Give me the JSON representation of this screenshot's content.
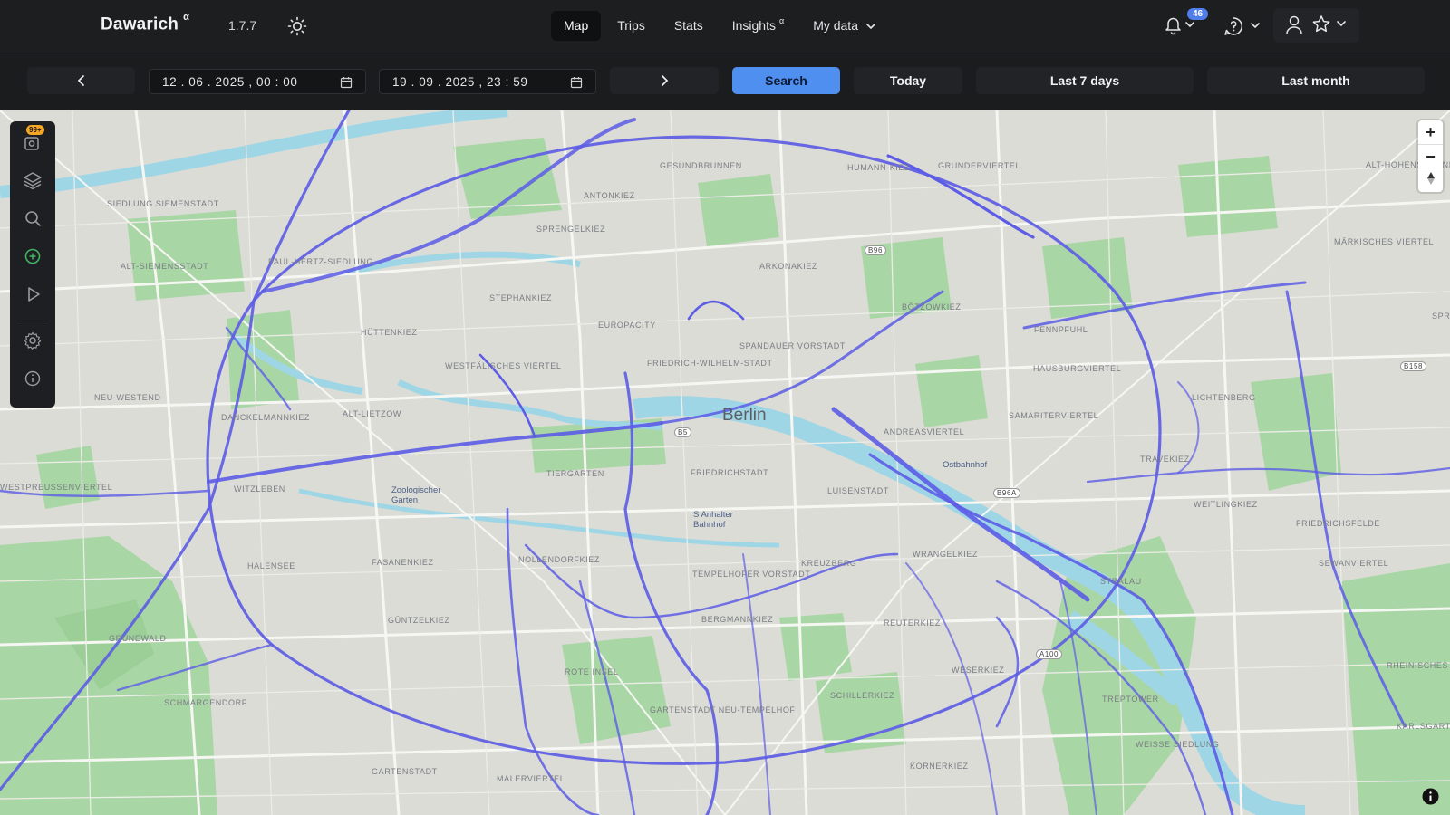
{
  "app": {
    "name": "Dawarich",
    "name_sup": "α",
    "version": "1.7.7"
  },
  "nav": {
    "links": [
      {
        "label": "Map",
        "active": true
      },
      {
        "label": "Trips"
      },
      {
        "label": "Stats"
      },
      {
        "label": "Insights",
        "sup": "α"
      },
      {
        "label": "My data",
        "dropdown": true
      }
    ]
  },
  "notifications": {
    "count": "46"
  },
  "toolbar": {
    "start_date": "12 . 06 . 2025 ,  00 : 00",
    "end_date": "19 . 09 . 2025 ,  23 : 59",
    "search_label": "Search",
    "today_label": "Today",
    "last7_label": "Last 7 days",
    "lastmonth_label": "Last month"
  },
  "sidebar": {
    "points_badge": "99+",
    "icons": [
      "points-icon",
      "layers-icon",
      "search-icon",
      "add-place-icon",
      "play-icon",
      "settings-icon",
      "info-icon"
    ]
  },
  "map": {
    "city_label": "Berlin",
    "districts": [
      "SIEDLUNG SIEMENSTADT",
      "ALT-SIEMENSSTADT",
      "PAUL-HERTZ-SIEDLUNG",
      "HÜTTENKIEZ",
      "STEPHANKIEZ",
      "SPRENGELKIEZ",
      "ANTONKIEZ",
      "GESUNDBRUNNEN",
      "HUMANN-KIEZ",
      "GRUNDERVIERTEL",
      "ALT-HOHENSCHÖNHAUSEN",
      "ARKONAKIEZ",
      "BÖTZOWKIEZ",
      "MÄRKISCHES VIERTEL",
      "FENNPFUHL",
      "EUROPACITY",
      "WESTFÄLISCHES VIERTEL",
      "FRIEDRICH-WILHELM-STADT",
      "SPANDAUER VORSTADT",
      "HAUSBURGVIERTEL",
      "LICHTENBERG",
      "SPRINGPF",
      "NEU-WESTEND",
      "DANCKELMANNKIEZ",
      "ALT-LIETZOW",
      "SAMARITERVIERTEL",
      "ANDREASVIERTEL",
      "TRAVEKIEZ",
      "WESTPREUSSENVIERTEL",
      "WITZLEBEN",
      "TIERGARTEN",
      "FRIEDRICHSTADT",
      "LUISENSTADT",
      "WEITLINGKIEZ",
      "FRIEDRICHSFELDE",
      "HALENSEE",
      "FASANENKIEZ",
      "NOLLENDORFKIEZ",
      "TEMPELHOFER VORSTADT",
      "KREUZBERG",
      "WRANGELKIEZ",
      "SEWANVIERTEL",
      "GRUNEWALD",
      "GÜNTZELKIEZ",
      "BERGMANNKIEZ",
      "REUTERKIEZ",
      "STRALAU",
      "ROTE INSEL",
      "WESERKIEZ",
      "RHEINISCHES VIERTEL",
      "SCHMARGENDORF",
      "GARTENSTADT NEU-TEMPELHOF",
      "SCHILLERKIEZ",
      "KARLSGARTEN",
      "TREPTOWER",
      "WEISSE SIEDLUNG",
      "GARTENSTADT",
      "MALERVIERTEL",
      "KÖRNERKIEZ"
    ],
    "pois": [
      "Zoologischer Garten",
      "Ostbahnhof",
      "S Anhalter Bahnhof"
    ],
    "shields": [
      "B5",
      "B96",
      "B96a",
      "A100",
      "B158"
    ]
  },
  "colors": {
    "route": "#5c5ce6",
    "park": "#a9d6a5",
    "water": "#9fd6e6",
    "land": "#dcdcd6",
    "road": "#f6f6f3",
    "primary_button": "#4f8ff0"
  }
}
